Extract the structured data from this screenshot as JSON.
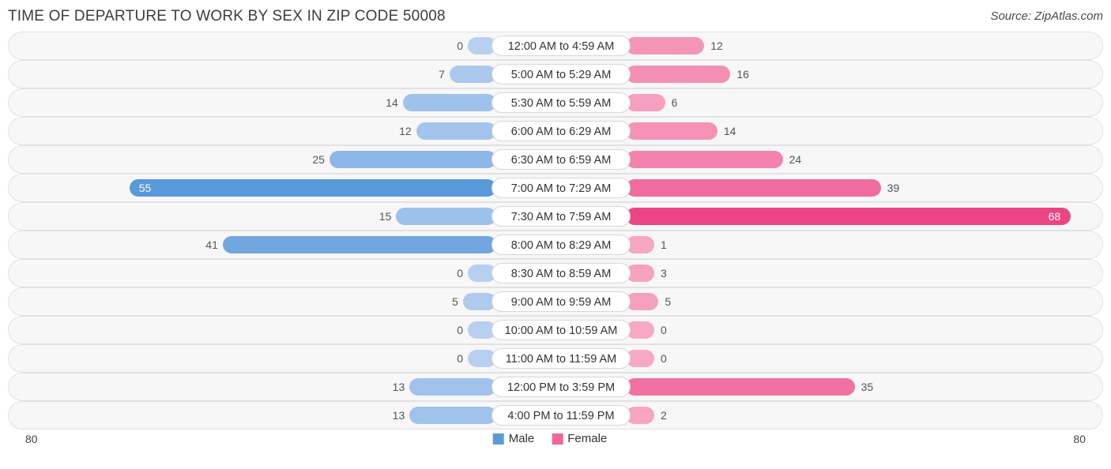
{
  "header": {
    "title": "TIME OF DEPARTURE TO WORK BY SEX IN ZIP CODE 50008",
    "source": "Source: ZipAtlas.com"
  },
  "legend": {
    "male_label": "Male",
    "female_label": "Female",
    "male_color": "#5b9bd5",
    "female_color": "#f0659a"
  },
  "axis": {
    "left": "80",
    "right": "80"
  },
  "chart_data": {
    "type": "bar",
    "title": "TIME OF DEPARTURE TO WORK BY SEX IN ZIP CODE 50008",
    "orientation": "horizontal-diverging",
    "xlabel": "",
    "ylabel": "",
    "xlim": [
      80,
      80
    ],
    "grid": false,
    "legend_position": "bottom-center",
    "categories": [
      "12:00 AM to 4:59 AM",
      "5:00 AM to 5:29 AM",
      "5:30 AM to 5:59 AM",
      "6:00 AM to 6:29 AM",
      "6:30 AM to 6:59 AM",
      "7:00 AM to 7:29 AM",
      "7:30 AM to 7:59 AM",
      "8:00 AM to 8:29 AM",
      "8:30 AM to 8:59 AM",
      "9:00 AM to 9:59 AM",
      "10:00 AM to 10:59 AM",
      "11:00 AM to 11:59 AM",
      "12:00 PM to 3:59 PM",
      "4:00 PM to 11:59 PM"
    ],
    "series": [
      {
        "name": "Male",
        "color": "#5b9bd5",
        "values": [
          0,
          7,
          14,
          12,
          25,
          55,
          15,
          41,
          0,
          5,
          0,
          0,
          13,
          13
        ]
      },
      {
        "name": "Female",
        "color": "#f0659a",
        "values": [
          12,
          16,
          6,
          14,
          24,
          39,
          68,
          1,
          3,
          5,
          0,
          0,
          35,
          2
        ]
      }
    ]
  }
}
